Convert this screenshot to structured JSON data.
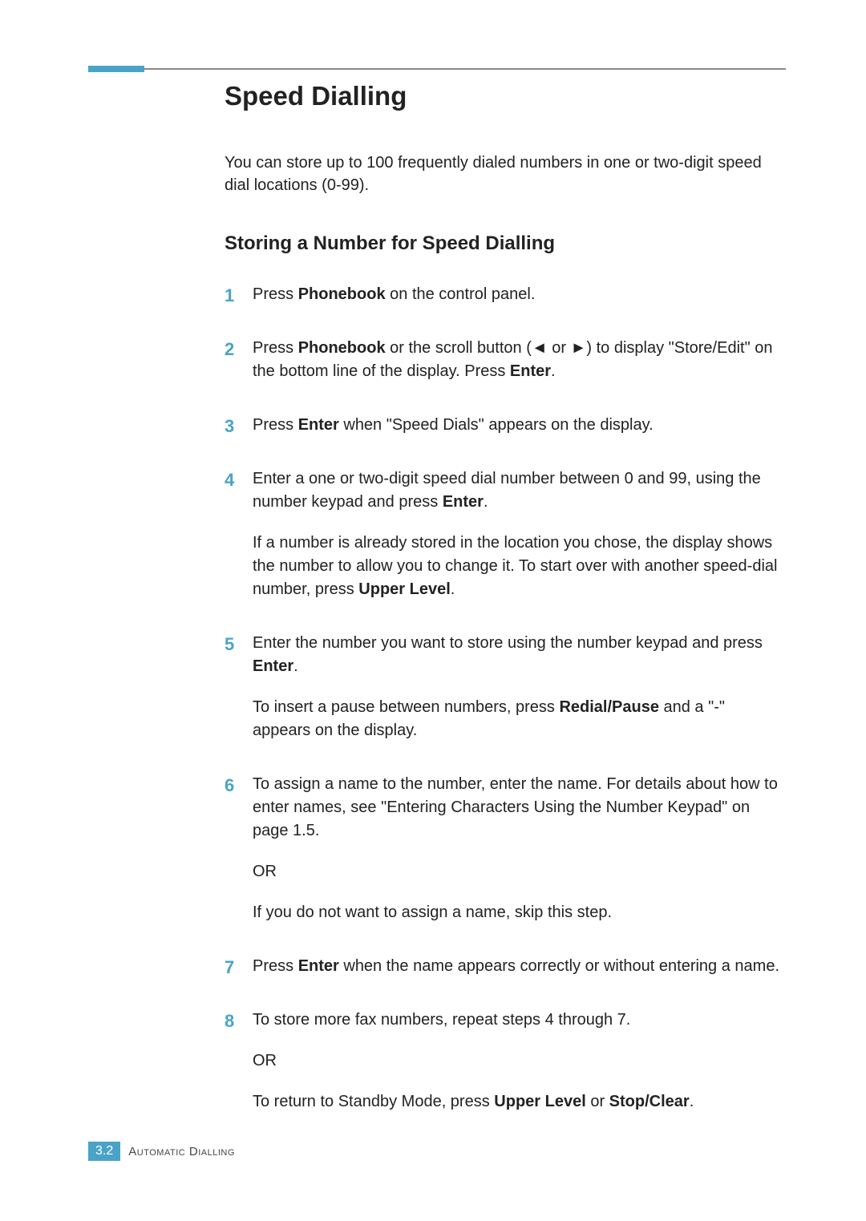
{
  "title": "Speed Dialling",
  "intro": "You can store up to 100 frequently dialed numbers in one or two-digit speed dial locations (0-99).",
  "subheading": "Storing a Number for Speed Dialling",
  "steps": {
    "s1": {
      "num": "1",
      "t1a": "Press ",
      "t1b": "Phonebook",
      "t1c": " on the control panel."
    },
    "s2": {
      "num": "2",
      "t1a": "Press ",
      "t1b": "Phonebook",
      "t1c": " or the scroll button (",
      "t1d": "◄",
      "t1e": " or ",
      "t1f": "►",
      "t1g": ") to display \"Store/Edit\" on the bottom line of the display. Press ",
      "t1h": "Enter",
      "t1i": "."
    },
    "s3": {
      "num": "3",
      "t1a": "Press ",
      "t1b": "Enter",
      "t1c": " when \"Speed Dials\" appears on the display."
    },
    "s4": {
      "num": "4",
      "p1a": "Enter a one or two-digit speed dial number between 0 and 99, using the number keypad and press ",
      "p1b": "Enter",
      "p1c": ".",
      "p2a": "If a number is already stored in the location you chose, the display shows the number to allow you to change it. To start over with another speed-dial number, press ",
      "p2b": "Upper Level",
      "p2c": "."
    },
    "s5": {
      "num": "5",
      "p1a": "Enter the number you want to store using the number keypad and press ",
      "p1b": "Enter",
      "p1c": ".",
      "p2a": "To insert a pause between numbers, press ",
      "p2b": "Redial/Pause",
      "p2c": " and a \"-\" appears on the display."
    },
    "s6": {
      "num": "6",
      "p1": "To assign a name to the number, enter the name. For details about how to enter names, see \"Entering Characters Using the Number Keypad\" on page 1.5.",
      "p2": "OR",
      "p3": "If you do not want to assign a name, skip this step."
    },
    "s7": {
      "num": "7",
      "t1a": "Press ",
      "t1b": "Enter",
      "t1c": " when the name appears correctly or without entering a name."
    },
    "s8": {
      "num": "8",
      "p1": "To store more fax numbers, repeat steps 4 through 7.",
      "p2": "OR",
      "p3a": "To return to Standby Mode, press ",
      "p3b": "Upper Level",
      "p3c": " or ",
      "p3d": "Stop/Clear",
      "p3e": "."
    }
  },
  "footer": {
    "page": "3",
    "sep": ".",
    "page2": "2",
    "section": "Automatic Dialling"
  }
}
